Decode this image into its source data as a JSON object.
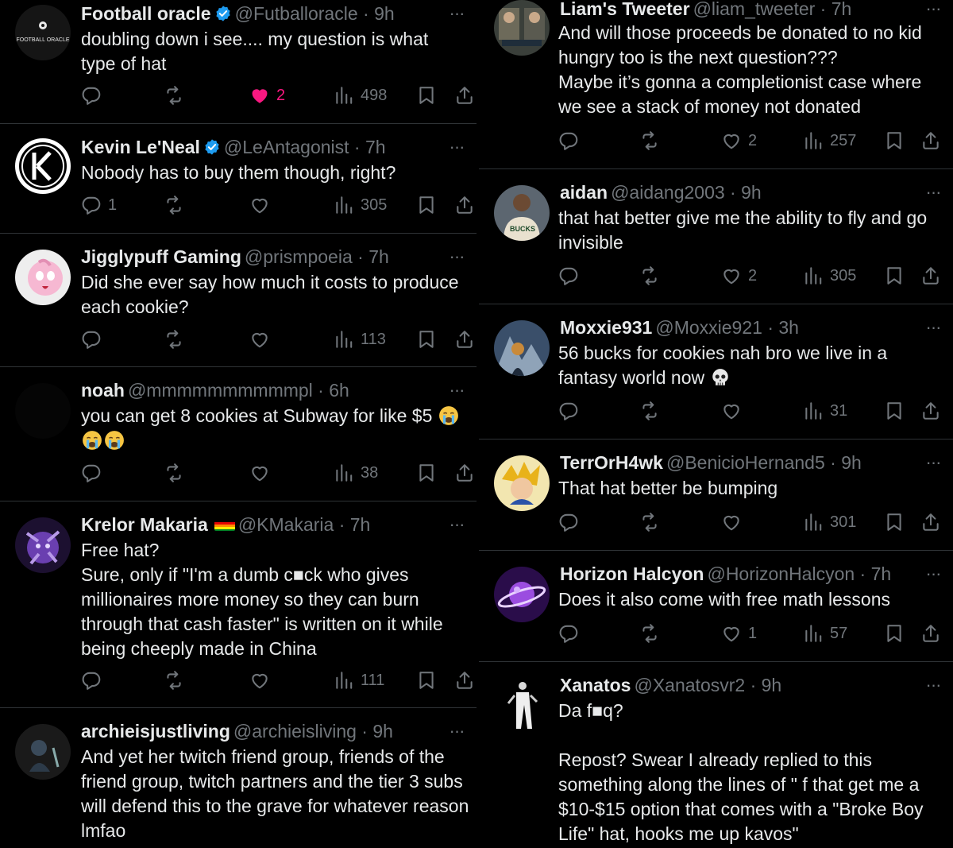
{
  "left_column": [
    {
      "name": "Football oracle",
      "verified": true,
      "handle": "@Futballoracle",
      "time": "9h",
      "avatar_text": "FOOTBALL ORACLE",
      "text": "doubling down i see.... my question is what type of hat",
      "replies": "",
      "likes": "2",
      "views": "498"
    },
    {
      "name": "Kevin Le'Neal",
      "verified": true,
      "handle": "@LeAntagonist",
      "time": "7h",
      "text": "Nobody has to buy them though, right?",
      "replies": "1",
      "likes": "",
      "views": "305"
    },
    {
      "name": "Jigglypuff Gaming",
      "handle": "@prismpoeia",
      "time": "7h",
      "text": "Did she ever say how much it costs to produce each cookie?",
      "replies": "",
      "likes": "",
      "views": "113"
    },
    {
      "name": "noah",
      "handle": "@mmmmmmmmmmpl",
      "time": "6h",
      "text": "you can get 8 cookies at Subway for like $5",
      "replies": "",
      "likes": "",
      "views": "38"
    },
    {
      "name": "Krelor Makaria",
      "handle": "@KMakaria",
      "time": "7h",
      "text": "Free hat?\nSure, only if \"I'm a dumb c■ck who gives millionaires more money so they can burn through that cash faster\" is written on it while being cheeply made in China",
      "replies": "",
      "likes": "",
      "views": "111"
    },
    {
      "name": "archieisjustliving",
      "handle": "@archieisliving",
      "time": "9h",
      "text": "And yet her twitch friend group, friends of the friend group, twitch partners and the tier 3 subs will defend this to the grave for whatever reason lmfao"
    }
  ],
  "right_column": [
    {
      "name": "Liam's Tweeter",
      "handle": "@liam_tweeter",
      "time": "7h",
      "text": "And will those proceeds be donated to no kid hungry too is the next question???\nMaybe it’s gonna a completionist case where we see a stack of money not donated",
      "replies": "",
      "likes": "2",
      "views": "257"
    },
    {
      "name": "aidan",
      "handle": "@aidang2003",
      "time": "9h",
      "avatar_text": "BUCKS",
      "text": "that hat better give me the ability to fly and go invisible",
      "replies": "",
      "likes": "2",
      "views": "305"
    },
    {
      "name": "Moxxie931",
      "handle": "@Moxxie921",
      "time": "3h",
      "text": "56 bucks for cookies nah bro we live in a fantasy world now",
      "replies": "",
      "likes": "",
      "views": "31"
    },
    {
      "name": "TerrOrH4wk",
      "handle": "@BenicioHernand5",
      "time": "9h",
      "text": "That hat better be bumping",
      "replies": "",
      "likes": "",
      "views": "301"
    },
    {
      "name": "Horizon Halcyon",
      "handle": "@HorizonHalcyon",
      "time": "7h",
      "text": "Does it also come with free math lessons",
      "replies": "",
      "likes": "1",
      "views": "57"
    },
    {
      "name": "Xanatos",
      "handle": "@Xanatosvr2",
      "time": "9h",
      "text": "Da f■q?\n\nRepost? Swear I already replied to this something along the lines of \" f that get me a $10-$15 option that comes with a \"Broke Boy Life\" hat, hooks me up kavos\""
    }
  ],
  "ui": {
    "time_separator": " · ",
    "more_glyph": "···"
  },
  "colors": {
    "background": "#000000",
    "text": "#e7e9ea",
    "secondary": "#71767b",
    "verified": "#1d9bf0",
    "like": "#f91880",
    "divider": "#2f3336"
  }
}
